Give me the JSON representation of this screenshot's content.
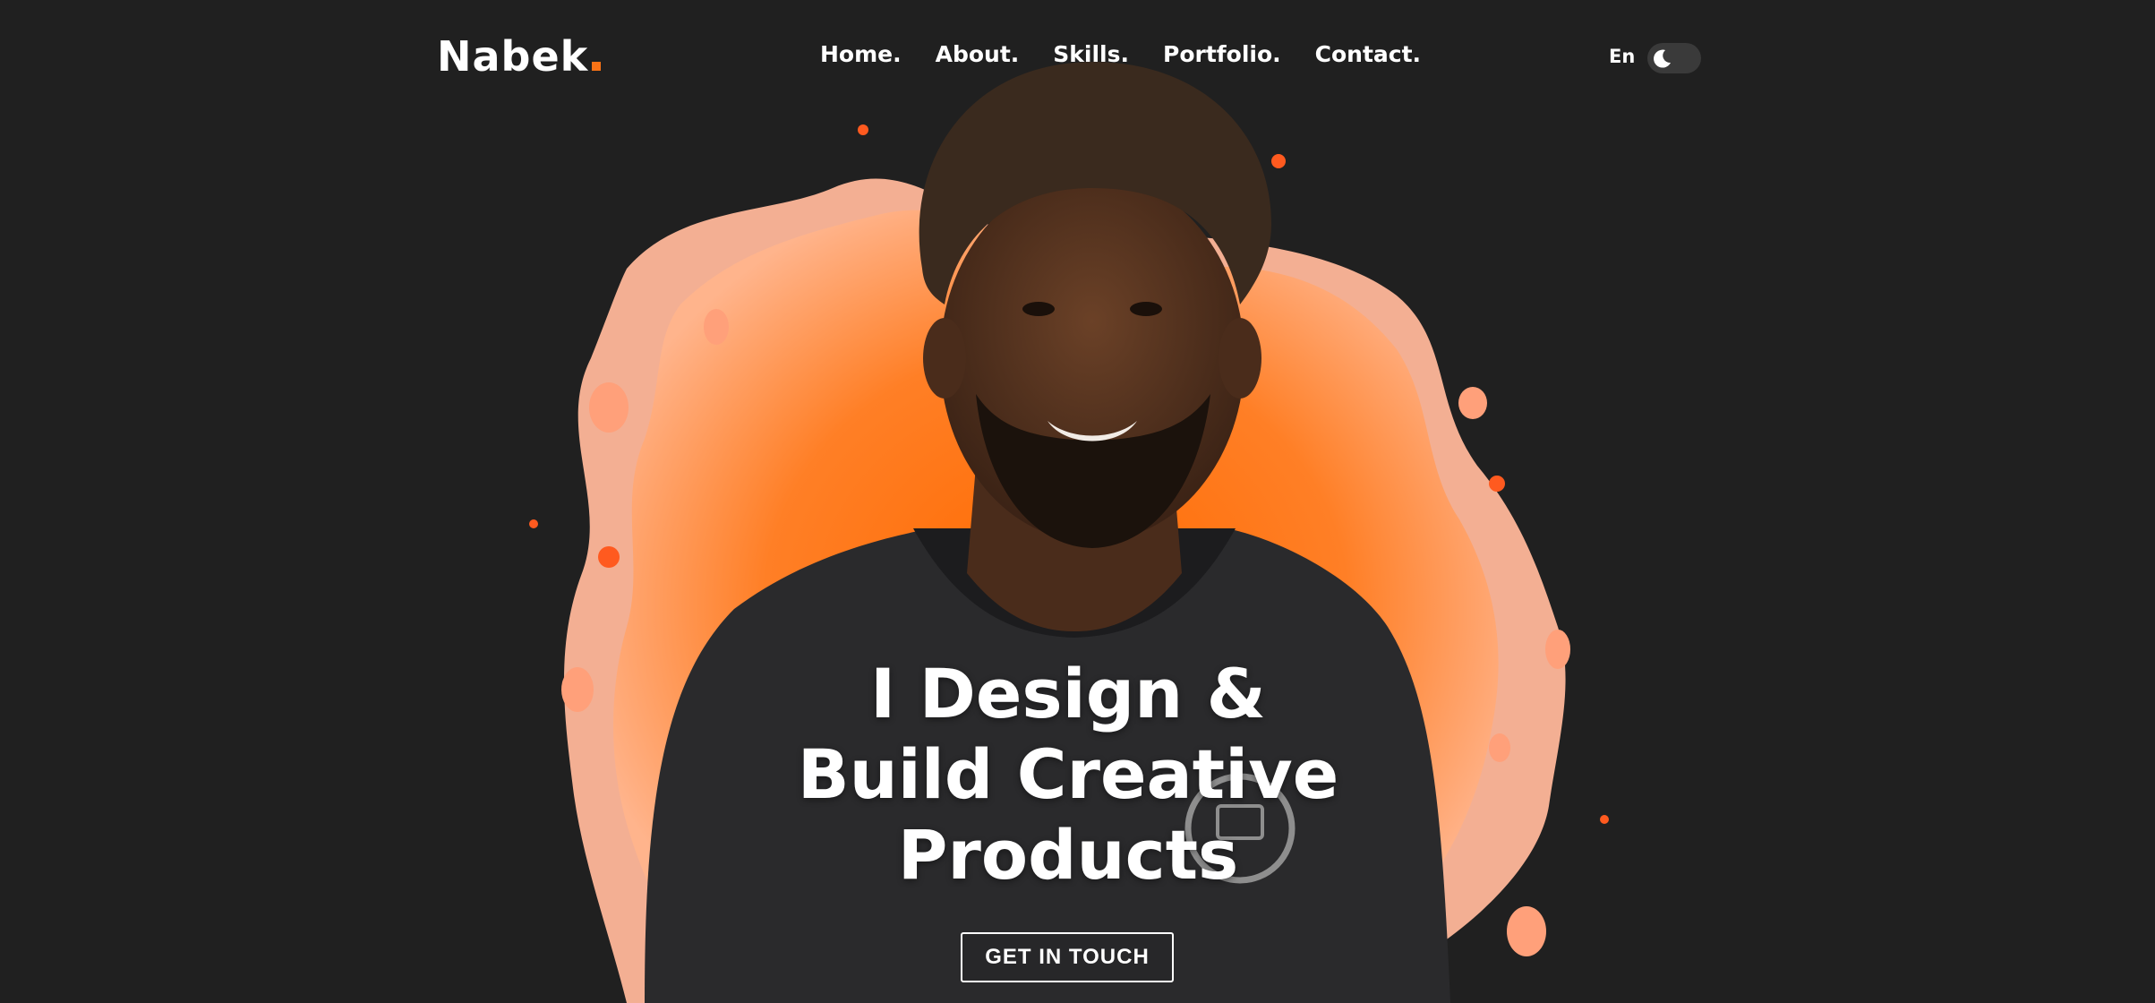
{
  "brand": {
    "logo_text": "Nabek",
    "accent_color": "#f97316"
  },
  "nav": {
    "items": [
      {
        "label": "Home."
      },
      {
        "label": "About."
      },
      {
        "label": "Skills."
      },
      {
        "label": "Portfolio."
      },
      {
        "label": "Contact."
      }
    ]
  },
  "settings": {
    "language": "En",
    "theme_icon": "moon-icon"
  },
  "hero": {
    "headline_lines": [
      "I Design &",
      "Build Creative",
      "Products"
    ],
    "cta_label": "GET IN TOUCH",
    "portrait": "person-portrait-with-orange-paint-splash"
  },
  "colors": {
    "background": "#202020",
    "text": "#ffffff",
    "splash_main": "#ff7a1a",
    "splash_light": "#ffb08a"
  }
}
